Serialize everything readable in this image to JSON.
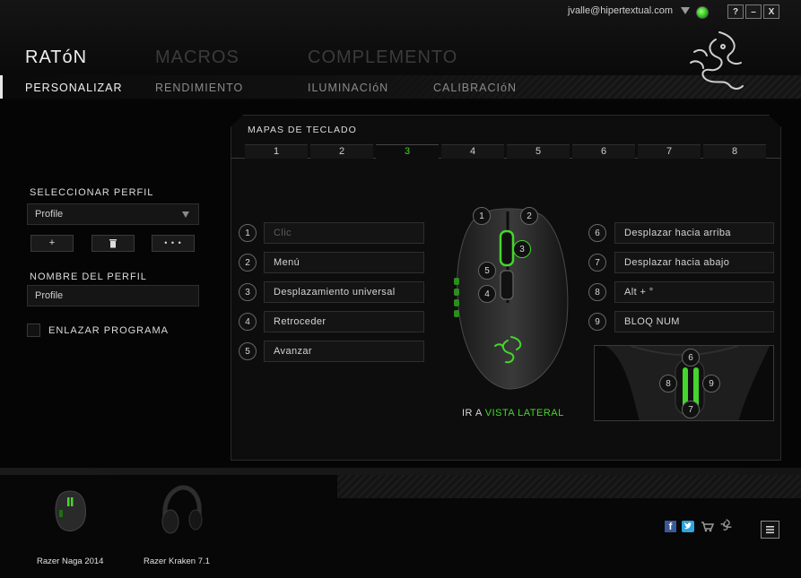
{
  "header": {
    "user_email": "jvalle@hipertextual.com",
    "window_buttons": [
      "?",
      "–",
      "X"
    ],
    "top_tabs": [
      "RATóN",
      "MACROS",
      "COMPLEMENTO"
    ],
    "sub_tabs": [
      "PERSONALIZAR",
      "RENDIMIENTO",
      "ILUMINACIóN",
      "CALIBRACIóN"
    ],
    "accent_color": "#44d62c"
  },
  "profile": {
    "select_label": "SELECCIONAR PERFIL",
    "selected": "Profile",
    "buttons": [
      "+",
      "🗑",
      "• • •"
    ],
    "name_label": "NOMBRE DEL PERFIL",
    "name_value": "Profile",
    "link_program": "ENLAZAR PROGRAMA"
  },
  "keymap": {
    "title": "MAPAS DE TECLADO",
    "tabs": [
      "1",
      "2",
      "3",
      "4",
      "5",
      "6",
      "7",
      "8"
    ],
    "active_tab": "3",
    "left": [
      {
        "num": "1",
        "action": "Clic"
      },
      {
        "num": "2",
        "action": "Menú"
      },
      {
        "num": "3",
        "action": "Desplazamiento universal"
      },
      {
        "num": "4",
        "action": "Retroceder"
      },
      {
        "num": "5",
        "action": "Avanzar"
      }
    ],
    "right": [
      {
        "num": "6",
        "action": "Desplazar hacia arriba"
      },
      {
        "num": "7",
        "action": "Desplazar hacia abajo"
      },
      {
        "num": "8",
        "action": "Alt + °"
      },
      {
        "num": "9",
        "action": "BLOQ NUM"
      }
    ],
    "mouse_labels": [
      "1",
      "2",
      "3",
      "5",
      "4"
    ],
    "side_labels": [
      "6",
      "8",
      "9",
      "7"
    ],
    "goto_prefix": "IR A",
    "goto_link": "VISTA LATERAL"
  },
  "devices": [
    {
      "name": "Razer Naga 2014"
    },
    {
      "name": "Razer Kraken 7.1"
    }
  ],
  "footer_icons": [
    "facebook-icon",
    "twitter-icon",
    "cart-icon",
    "razer-logo-icon",
    "menu-icon"
  ]
}
